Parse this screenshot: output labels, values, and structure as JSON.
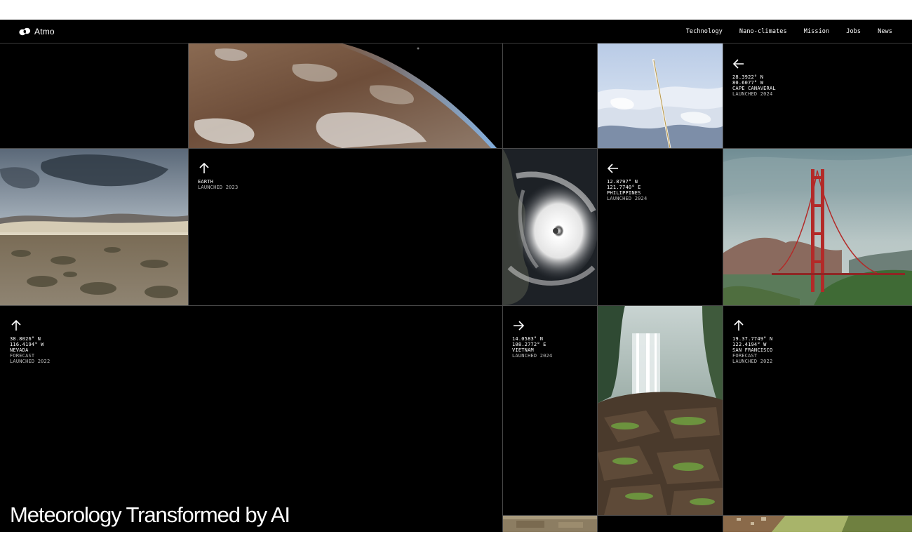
{
  "brand": {
    "name": "Atmo",
    "icon": "atmo-logo-icon"
  },
  "nav": [
    {
      "label": "Technology"
    },
    {
      "label": "Nano-climates"
    },
    {
      "label": "Mission"
    },
    {
      "label": "Jobs"
    },
    {
      "label": "News"
    }
  ],
  "hero": {
    "title": "Meteorology Transformed by AI"
  },
  "cards": {
    "cape_canaveral": {
      "arrow": "arrow-left-icon",
      "lat": "28.3922° N",
      "lon": "80.6077° W",
      "place": "CAPE CANAVERAL",
      "launched": "LAUNCHED 2024"
    },
    "earth": {
      "arrow": "arrow-up-icon",
      "place": "EARTH",
      "launched": "LAUNCHED 2023"
    },
    "philippines": {
      "arrow": "arrow-left-icon",
      "lat": "12.8797° N",
      "lon": "121.7740° E",
      "place": "PHILIPPINES",
      "launched": "LAUNCHED 2024"
    },
    "nevada": {
      "arrow": "arrow-up-icon",
      "lat": "38.8026° N",
      "lon": "116.4194° W",
      "place": "NEVADA",
      "tag": "FORECAST",
      "launched": "LAUNCHED 2022"
    },
    "vietnam": {
      "arrow": "arrow-right-icon",
      "lat": "14.0583° N",
      "lon": "108.2772° E",
      "place": "VIETNAM",
      "launched": "LAUNCHED 2024"
    },
    "san_francisco": {
      "arrow": "arrow-up-icon",
      "lat": "19.37.7749° N",
      "lon": "122.4194° W",
      "place": "SAN FRANCISCO",
      "tag": "FORECAST",
      "launched": "LAUNCHED 2022"
    }
  },
  "images": [
    "earth-from-space-photo",
    "rocket-launch-photo",
    "desert-storm-photo",
    "hurricane-satellite-photo",
    "golden-gate-bridge-photo",
    "waterfall-photo",
    "aerial-farmland-photo"
  ]
}
